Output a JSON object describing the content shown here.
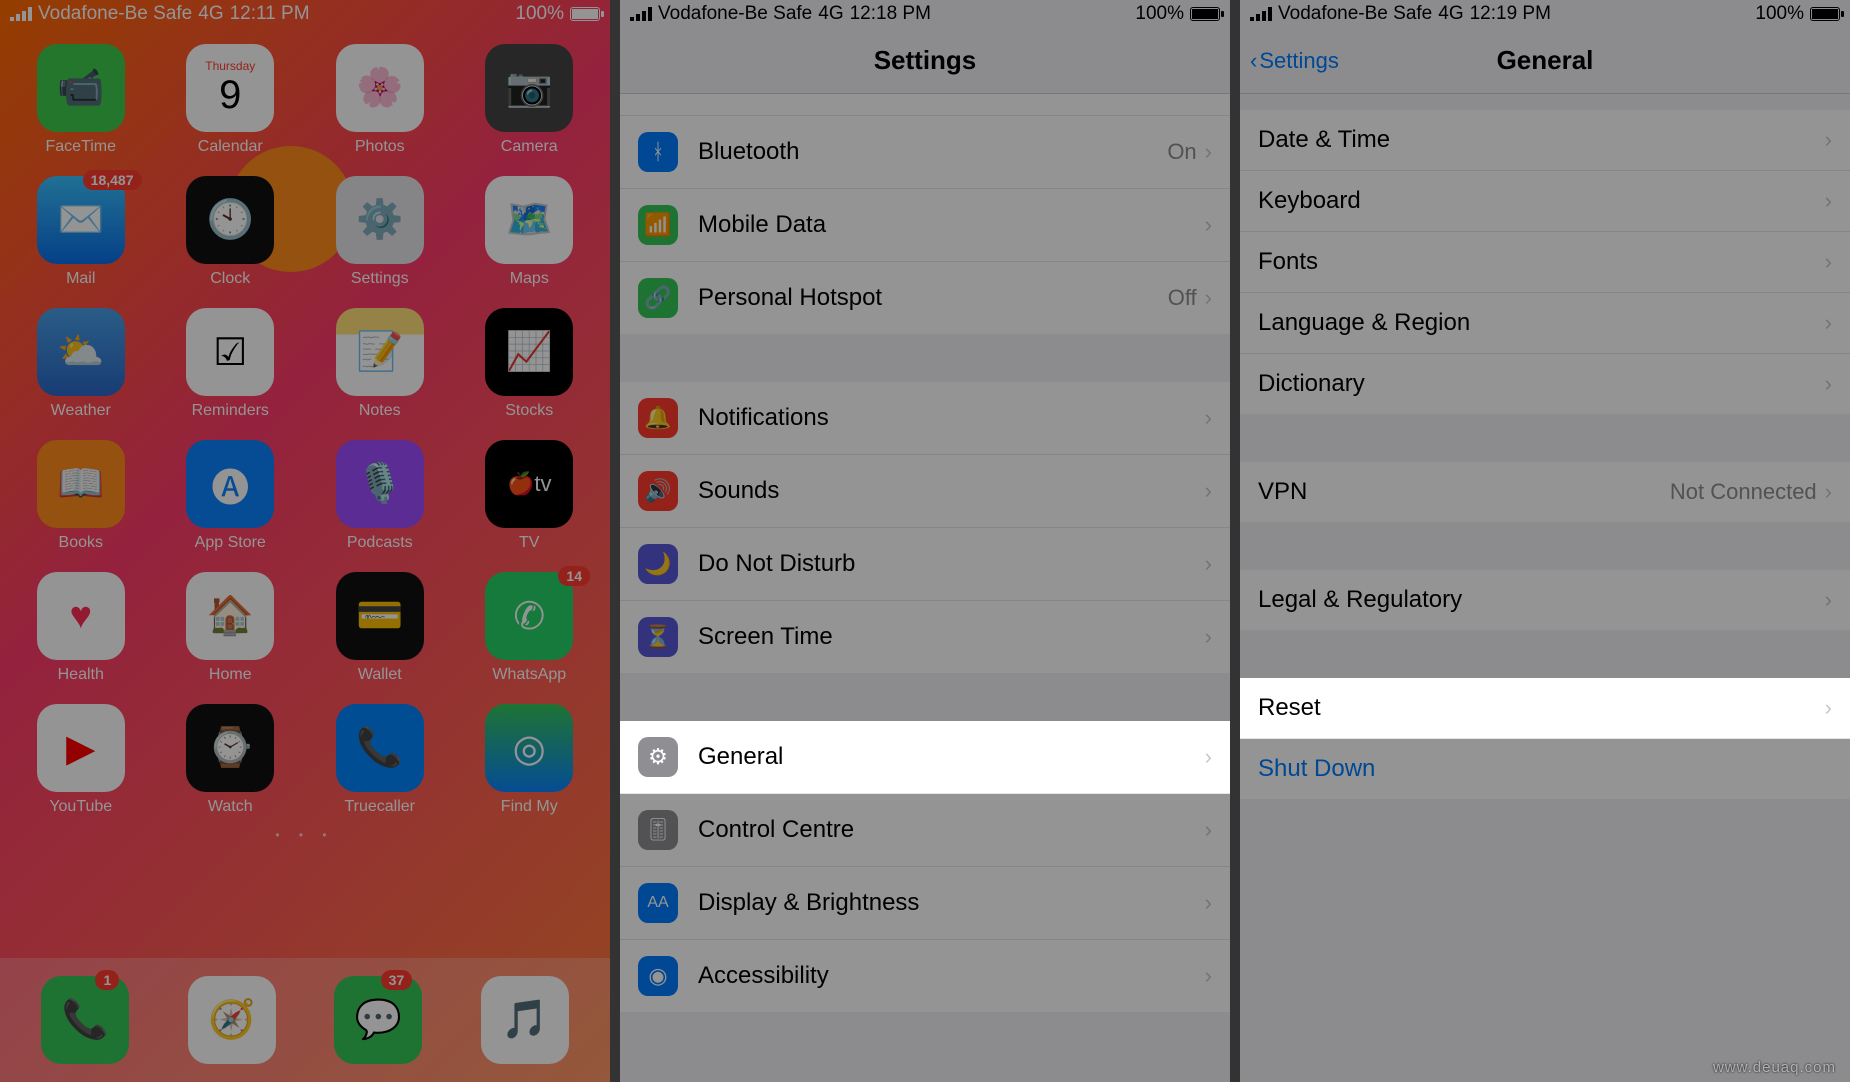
{
  "carrier": "Vodafone-Be Safe",
  "network": "4G",
  "times": {
    "s1": "12:11 PM",
    "s2": "12:18 PM",
    "s3": "12:19 PM"
  },
  "battery": "100%",
  "home": {
    "calendar_day_name": "Thursday",
    "calendar_day": "9",
    "mail_badge": "18,487",
    "whatsapp_badge": "14",
    "phone_badge": "1",
    "messages_badge": "37",
    "apps": [
      {
        "key": "facetime",
        "label": "FaceTime"
      },
      {
        "key": "calendar",
        "label": "Calendar"
      },
      {
        "key": "photos",
        "label": "Photos"
      },
      {
        "key": "camera",
        "label": "Camera"
      },
      {
        "key": "mail",
        "label": "Mail"
      },
      {
        "key": "clock",
        "label": "Clock"
      },
      {
        "key": "settings",
        "label": "Settings"
      },
      {
        "key": "maps",
        "label": "Maps"
      },
      {
        "key": "weather",
        "label": "Weather"
      },
      {
        "key": "reminders",
        "label": "Reminders"
      },
      {
        "key": "notes",
        "label": "Notes"
      },
      {
        "key": "stocks",
        "label": "Stocks"
      },
      {
        "key": "books",
        "label": "Books"
      },
      {
        "key": "appstore",
        "label": "App Store"
      },
      {
        "key": "podcasts",
        "label": "Podcasts"
      },
      {
        "key": "tv",
        "label": "TV"
      },
      {
        "key": "health",
        "label": "Health"
      },
      {
        "key": "home",
        "label": "Home"
      },
      {
        "key": "wallet",
        "label": "Wallet"
      },
      {
        "key": "whatsapp",
        "label": "WhatsApp"
      },
      {
        "key": "youtube",
        "label": "YouTube"
      },
      {
        "key": "watch",
        "label": "Watch"
      },
      {
        "key": "truecaller",
        "label": "Truecaller"
      },
      {
        "key": "findmy",
        "label": "Find My"
      }
    ]
  },
  "settings": {
    "title": "Settings",
    "rows": {
      "bluetooth": "Bluetooth",
      "bluetooth_val": "On",
      "mobile": "Mobile Data",
      "hotspot": "Personal Hotspot",
      "hotspot_val": "Off",
      "notifications": "Notifications",
      "sounds": "Sounds",
      "dnd": "Do Not Disturb",
      "screentime": "Screen Time",
      "general": "General",
      "controlcentre": "Control Centre",
      "display": "Display & Brightness",
      "accessibility": "Accessibility"
    }
  },
  "general": {
    "back": "Settings",
    "title": "General",
    "rows": {
      "datetime": "Date & Time",
      "keyboard": "Keyboard",
      "fonts": "Fonts",
      "language": "Language & Region",
      "dictionary": "Dictionary",
      "vpn": "VPN",
      "vpn_val": "Not Connected",
      "legal": "Legal & Regulatory",
      "reset": "Reset",
      "shutdown": "Shut Down"
    }
  },
  "watermark": "www.deuaq.com"
}
